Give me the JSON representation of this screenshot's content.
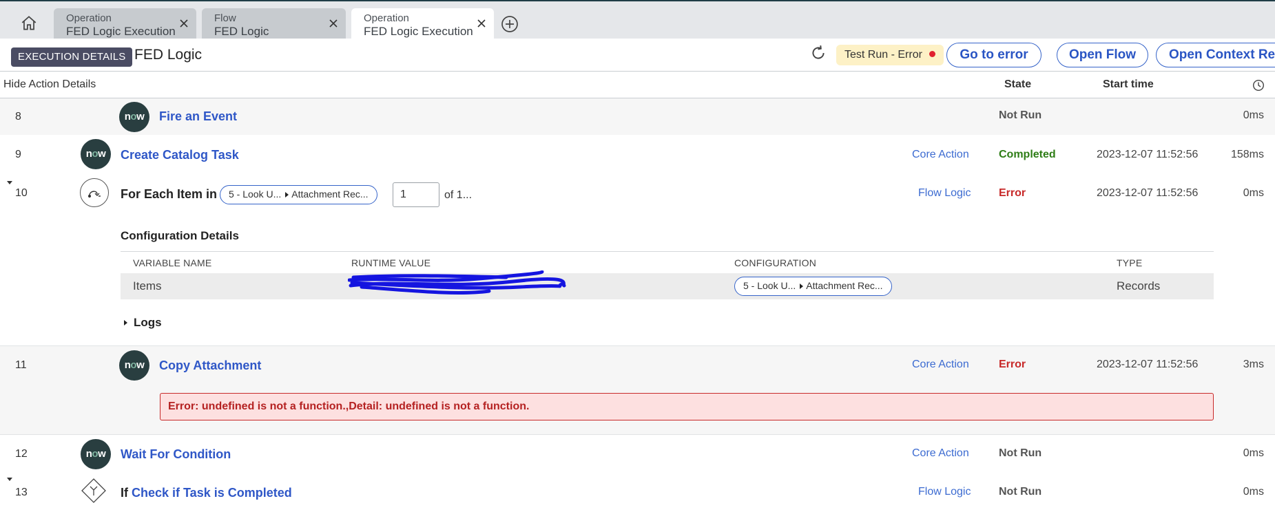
{
  "tabs": [
    {
      "type": "Operation",
      "name": "FED Logic Execution"
    },
    {
      "type": "Flow",
      "name": "FED Logic"
    },
    {
      "type": "Operation",
      "name": "FED Logic Execution"
    }
  ],
  "header": {
    "badge": "EXECUTION DETAILS",
    "flow_name": "FED Logic",
    "status": "Test Run - Error",
    "buttons": {
      "go_to_error": "Go to error",
      "open_flow": "Open Flow",
      "open_context": "Open Context Record"
    }
  },
  "columns": {
    "hide_details": "Hide Action Details",
    "state": "State",
    "start_time": "Start time"
  },
  "steps": {
    "s8": {
      "num": "8",
      "icon": "now-logo",
      "name": "Fire an Event",
      "category": "",
      "state": "Not Run",
      "start": "",
      "duration": "0ms"
    },
    "s9": {
      "num": "9",
      "icon": "now-logo",
      "name": "Create Catalog Task",
      "category": "Core Action",
      "state": "Completed",
      "start": "2023-12-07 11:52:56",
      "duration": "158ms"
    },
    "s10": {
      "num": "10",
      "icon": "for-each-icon",
      "name": "For Each Item in",
      "pill_a": "5 - Look U...",
      "pill_b": "Attachment Rec...",
      "iteration": "1",
      "iteration_of": "of 1...",
      "category": "Flow Logic",
      "state": "Error",
      "start": "2023-12-07 11:52:56",
      "duration": "0ms"
    },
    "s11": {
      "num": "11",
      "icon": "now-logo",
      "name": "Copy Attachment",
      "category": "Core Action",
      "state": "Error",
      "start": "2023-12-07 11:52:56",
      "duration": "3ms",
      "error": "Error: undefined is not a function.,Detail: undefined is not a function."
    },
    "s12": {
      "num": "12",
      "icon": "now-logo",
      "name": "Wait For Condition",
      "category": "Core Action",
      "state": "Not Run",
      "start": "",
      "duration": "0ms"
    },
    "s13": {
      "num": "13",
      "icon": "if-icon",
      "prefix": "If",
      "name": "Check if Task is Completed",
      "category": "Flow Logic",
      "state": "Not Run",
      "start": "",
      "duration": "0ms"
    }
  },
  "now_logo": {
    "n": "n",
    "o": "o",
    "w": "w"
  },
  "config": {
    "title": "Configuration Details",
    "headers": {
      "variable": "VARIABLE NAME",
      "runtime": "RUNTIME VALUE",
      "configuration": "CONFIGURATION",
      "type": "TYPE"
    },
    "row": {
      "variable": "Items",
      "config_a": "5 - Look U...",
      "config_b": "Attachment Rec...",
      "type": "Records"
    }
  },
  "logs_label": "Logs",
  "colors": {
    "accent": "#2f57c7",
    "error": "#c72828",
    "success": "#2e7d16",
    "badge": "#4a4c63",
    "status_bg": "#fdf1c6"
  }
}
